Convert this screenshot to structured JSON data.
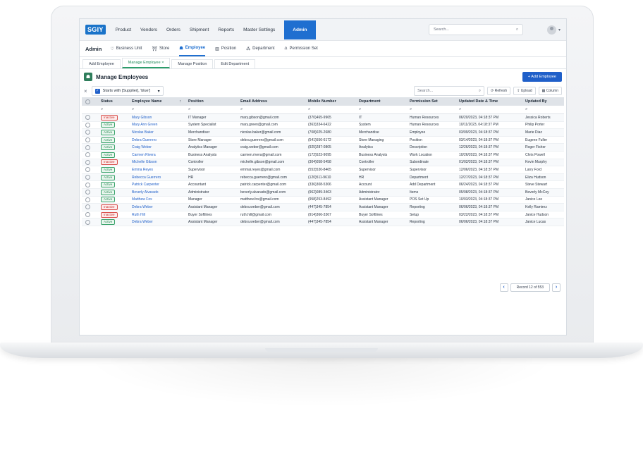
{
  "brand": "SGIY",
  "topnav": {
    "items": [
      "Product",
      "Vendors",
      "Orders",
      "Shipment",
      "Reports",
      "Master Settings"
    ],
    "active": "Admin",
    "search_placeholder": "Search..."
  },
  "subnav": {
    "section": "Admin",
    "items": [
      {
        "icon": "♡",
        "label": "Business Unit"
      },
      {
        "icon": "⛩",
        "label": "Store"
      },
      {
        "icon": "☗",
        "label": "Employee"
      },
      {
        "icon": "▥",
        "label": "Position"
      },
      {
        "icon": "⁂",
        "label": "Department"
      },
      {
        "icon": "⩍",
        "label": "Permission Set"
      }
    ]
  },
  "tabs": [
    "Add Employee",
    "Manage Employee",
    "Manage Position",
    "Edit Department"
  ],
  "tab_close": "×",
  "page": {
    "title": "Manage Employees",
    "add_button": "+ Add Employee"
  },
  "filter": {
    "clear": "×",
    "chip_text": "Starts with [Supplier], 'blue']",
    "search_placeholder": "Search...",
    "refresh": "⟳ Refresh",
    "upload": "⇪ Upload",
    "column": "▦ Column"
  },
  "table": {
    "headers": [
      "Status",
      "Employee Name",
      "Position",
      "Email Address",
      "Mobile Number",
      "Department",
      "Permission Set",
      "Updated Date & Time",
      "Updated By"
    ],
    "rows": [
      [
        "Inactive",
        "Mary Gibson",
        "IT Manager",
        "mary.gibson@gmail.com",
        "(370)465-9965",
        "IT",
        "Human Resources",
        "06/20/2023, 04:18:37 PM",
        "Jessica Roberts"
      ],
      [
        "Active",
        "Mary Ann Green",
        "System Specialist",
        "mary.green@gmail.com",
        "(363)334-6422",
        "System",
        "Human Resources",
        "10/11/2023, 04:18:37 PM",
        "Philip Porter"
      ],
      [
        "Active",
        "Nicolas Baker",
        "Merchandiser",
        "nicolas.baker@gmail.com",
        "(708)025-2680",
        "Merchandise",
        "Employee",
        "03/09/2023, 04:18:37 PM",
        "Marie Diaz"
      ],
      [
        "Active",
        "Debra Guerrero",
        "Store Manager",
        "debra.guerrero@gmail.com",
        "(541)556-6172",
        "Store Managing",
        "Position",
        "03/14/2023, 04:18:37 PM",
        "Eugene Fuller"
      ],
      [
        "Active",
        "Craig Weber",
        "Analytics Manager",
        "craig.weber@gmail.com",
        "(925)287-0805",
        "Analytics",
        "Description",
        "12/26/2023, 04:18:37 PM",
        "Roger Fisher"
      ],
      [
        "Active",
        "Carmen Rivera",
        "Business Analysts",
        "carmen.rivera@gmail.com",
        "(172)523-9095",
        "Business Analysts",
        "Work Location",
        "10/26/2023, 04:18:37 PM",
        "Chris Powell"
      ],
      [
        "Inactive",
        "Michelle Gibson",
        "Controller",
        "michelle.gibson@gmail.com",
        "(304)058-5458",
        "Controller",
        "Subordinate",
        "01/02/2023, 04:18:37 PM",
        "Kevin Murphy"
      ],
      [
        "Active",
        "Emma Reyes",
        "Supervisor",
        "emmai.reyes@gmail.com",
        "(553)530-8465",
        "Supervisor",
        "Supervisor",
        "12/06/2023, 04:18:37 PM",
        "Larry Ford"
      ],
      [
        "Active",
        "Rebecca Guerrero",
        "HR",
        "rebecca.guerrero@gmail.com",
        "(120)511-9610",
        "HR",
        "Department",
        "12/27/2023, 04:18:37 PM",
        "Eliza Hudson"
      ],
      [
        "Active",
        "Patrick Carpenter",
        "Accountant",
        "patrick.carpenter@gmail.com",
        "(336)308-5306",
        "Account",
        "Add Department",
        "06/24/2023, 04:18:37 PM",
        "Steve Stewart"
      ],
      [
        "Active",
        "Beverly Alvarado",
        "Administrator",
        "beverly.alvarado@gmail.com",
        "(962)089-3463",
        "Administrator",
        "Items",
        "05/08/2023, 04:18:37 PM",
        "Beverly McCoy"
      ],
      [
        "Active",
        "Matthew Fox",
        "Manager",
        "matthew.fox@gmail.com",
        "(958)253-8492",
        "Assistant Manager",
        "POS Set Up",
        "10/03/2023, 04:18:37 PM",
        "Janice Lee"
      ],
      [
        "Inactive",
        "Debra Weber",
        "Assistant Manager",
        "debra.weber@gmail.com",
        "(447)345-7854",
        "Assistant Manager",
        "Reporting",
        "06/06/2023, 04:18:37 PM",
        "Kelly Ramirez"
      ],
      [
        "Inactive",
        "Ruth Hill",
        "Buyer Softlines",
        "ruth.hill@gmail.com",
        "(914)366-3367",
        "Buyer Softlines",
        "Setup",
        "03/22/2023, 04:18:37 PM",
        "Janice Hudson"
      ],
      [
        "Active",
        "Debra Weber",
        "Assistant Manager",
        "debra.weber@gmail.com",
        "(447)345-7854",
        "Assistant Manager",
        "Reporting",
        "06/06/2023, 04:18:37 PM",
        "Janice Lucas"
      ]
    ]
  },
  "pagination": {
    "prev": "‹",
    "next": "›",
    "record_text": "Record 12 of 553"
  }
}
